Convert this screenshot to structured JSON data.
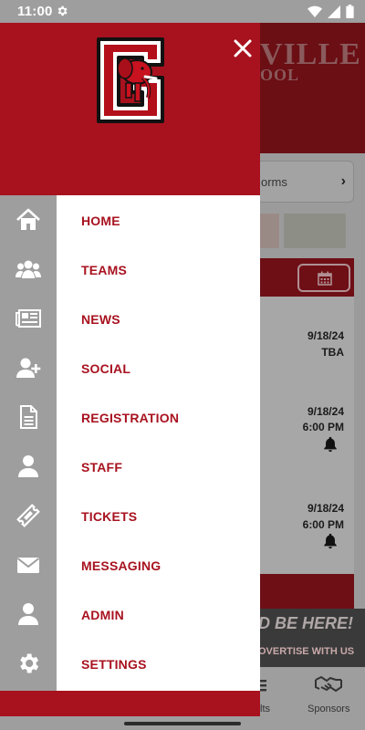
{
  "status_bar": {
    "time": "11:00",
    "settings_icon": "gear-icon",
    "wifi_icon": "wifi-icon",
    "signal_icon": "cell-signal-icon",
    "battery_icon": "battery-icon"
  },
  "background": {
    "title_partial": "VILLE",
    "subtitle_partial": "OOL",
    "forms_label": "orms",
    "calendar_icon": "calendar-icon",
    "events": [
      {
        "date": "9/18/24",
        "time": "TBA",
        "bell": false
      },
      {
        "date": "9/18/24",
        "time": "6:00 PM",
        "bell": true
      },
      {
        "date": "9/18/24",
        "time": "6:00 PM",
        "bell": true
      }
    ],
    "ad_line1": "D BE HERE!",
    "ad_line2": "OVERTISE WITH US",
    "tabs": [
      {
        "label": "lts"
      },
      {
        "label": "Sponsors"
      }
    ]
  },
  "drawer": {
    "close_icon": "close-icon",
    "logo": "elephant-g-logo",
    "brand_color": "#a8121f",
    "rail_color": "#9e9e9e",
    "items": [
      {
        "label": "HOME",
        "icon": "home-icon"
      },
      {
        "label": "TEAMS",
        "icon": "users-icon"
      },
      {
        "label": "NEWS",
        "icon": "newspaper-icon"
      },
      {
        "label": "SOCIAL",
        "icon": "user-plus-icon"
      },
      {
        "label": "REGISTRATION",
        "icon": "document-icon"
      },
      {
        "label": "STAFF",
        "icon": "user-icon"
      },
      {
        "label": "TICKETS",
        "icon": "ticket-icon"
      },
      {
        "label": "MESSAGING",
        "icon": "envelope-icon"
      },
      {
        "label": "ADMIN",
        "icon": "user-icon"
      },
      {
        "label": "SETTINGS",
        "icon": "gear-icon"
      }
    ]
  }
}
